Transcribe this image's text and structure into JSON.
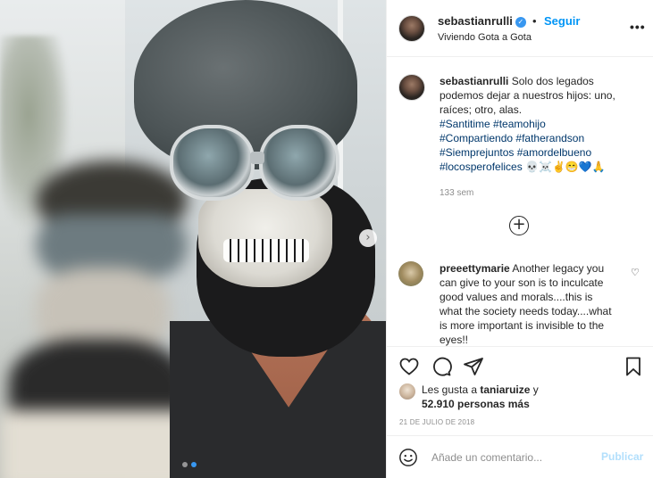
{
  "header": {
    "username": "sebastianrulli",
    "separator": "•",
    "follow_label": "Seguir",
    "location": "Viviendo Gota a Gota",
    "more_label": "•••"
  },
  "caption": {
    "username": "sebastianrulli",
    "text": "Solo dos legados podemos dejar a nuestros hijos: uno, raíces; otro, alas.",
    "hashtags": [
      "#Santitime",
      "#teamohijo",
      "#Compartiendo",
      "#fatherandson",
      "#Siemprejuntos",
      "#amordelbueno",
      "#locosperofelices"
    ],
    "emojis": "💀☠️✌️😁💙🙏",
    "time": "133 sem"
  },
  "load_more_label": "+",
  "comment": {
    "username": "preeettymarie",
    "text": "Another legacy you can give to your son is to inculcate good values and morals....this is what the society needs today....what is more important is invisible to the eyes!!"
  },
  "likes": {
    "prefix": "Les gusta a",
    "user": "taniaruize",
    "suffix": "y",
    "count_text": "52.910 personas más"
  },
  "date": "21 DE JULIO DE 2018",
  "add_comment": {
    "placeholder": "Añade un comentario...",
    "post_label": "Publicar"
  },
  "carousel": {
    "next_label": "›",
    "total_slides": 2,
    "active_slide": 2
  },
  "colors": {
    "accent": "#0095f6",
    "hashtag": "#00376b",
    "muted": "#8e8e8e",
    "post_disabled": "#b2dffc"
  }
}
